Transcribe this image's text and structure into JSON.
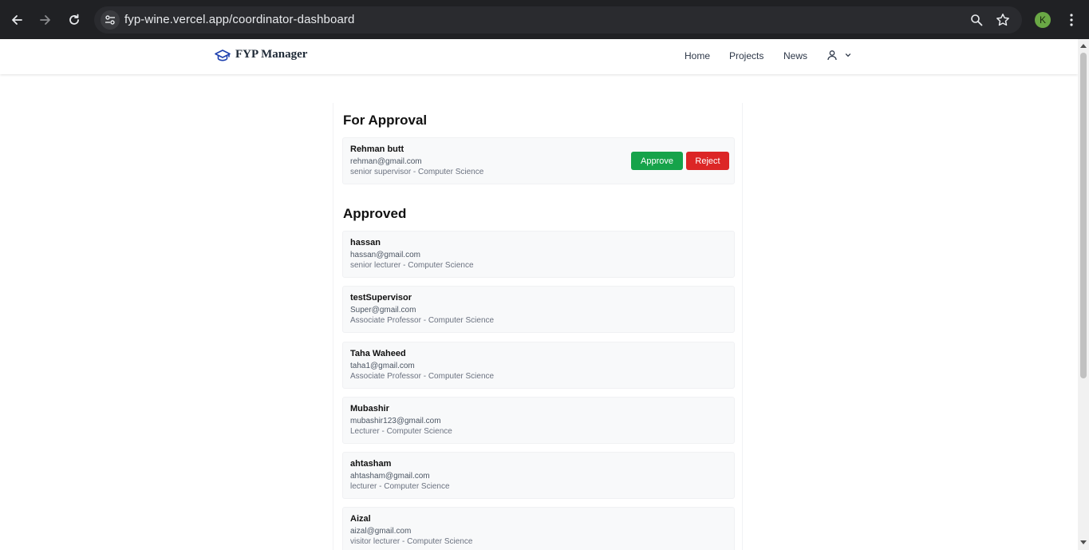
{
  "browser": {
    "url": "fyp-wine.vercel.app/coordinator-dashboard",
    "profile_initial": "K"
  },
  "header": {
    "brand": "FYP Manager",
    "nav": [
      "Home",
      "Projects",
      "News"
    ]
  },
  "pending": {
    "title": "For Approval",
    "items": [
      {
        "name": "Rehman butt",
        "email": "rehman@gmail.com",
        "role": "senior supervisor",
        "department": "Computer Science",
        "approve_label": "Approve",
        "reject_label": "Reject"
      }
    ]
  },
  "approved": {
    "title": "Approved",
    "items": [
      {
        "name": "hassan",
        "email": "hassan@gmail.com",
        "role": "senior lecturer",
        "department": "Computer Science"
      },
      {
        "name": "testSupervisor",
        "email": "Super@gmail.com",
        "role": "Associate Professor",
        "department": "Computer Science"
      },
      {
        "name": "Taha Waheed",
        "email": "taha1@gmail.com",
        "role": "Associate Professor",
        "department": "Computer Science"
      },
      {
        "name": "Mubashir",
        "email": "mubashir123@gmail.com",
        "role": "Lecturer",
        "department": "Computer Science"
      },
      {
        "name": "ahtasham",
        "email": "ahtasham@gmail.com",
        "role": "lecturer",
        "department": "Computer Science"
      },
      {
        "name": "Aizal",
        "email": "aizal@gmail.com",
        "role": "visitor lecturer",
        "department": "Computer Science"
      }
    ]
  },
  "colors": {
    "approve": "#16a34a",
    "reject": "#dc2626",
    "brand_icon": "#1e40af"
  }
}
